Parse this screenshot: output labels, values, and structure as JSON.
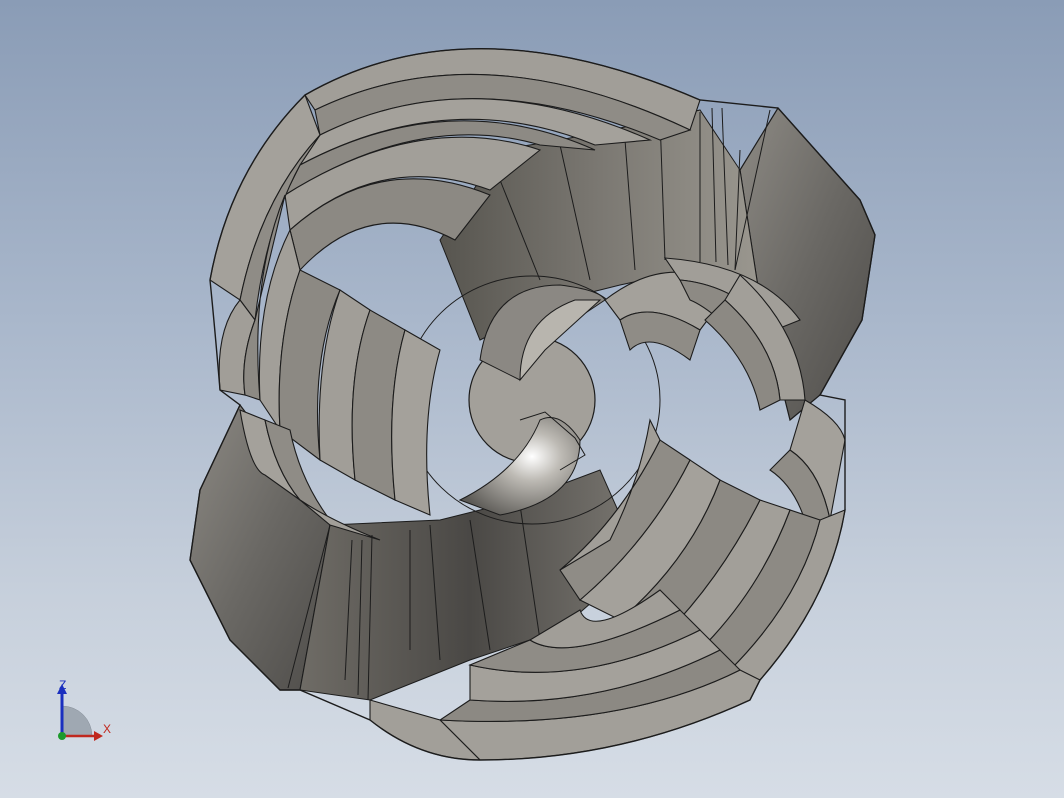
{
  "viewport": {
    "background_top": "#8a9cb6",
    "background_bottom": "#d6dde6"
  },
  "model": {
    "description_icon": "helical-flight-part",
    "face_light": "#a8a59f",
    "face_mid": "#8a8781",
    "face_dark": "#5f5d59",
    "edge": "#1c1c1c",
    "hub": "#a3a09a"
  },
  "triad": {
    "z_label": "Z",
    "x_label": "X",
    "z_color": "#1a2fbf",
    "x_color": "#c0281e",
    "y_color": "#1c9a2c"
  }
}
